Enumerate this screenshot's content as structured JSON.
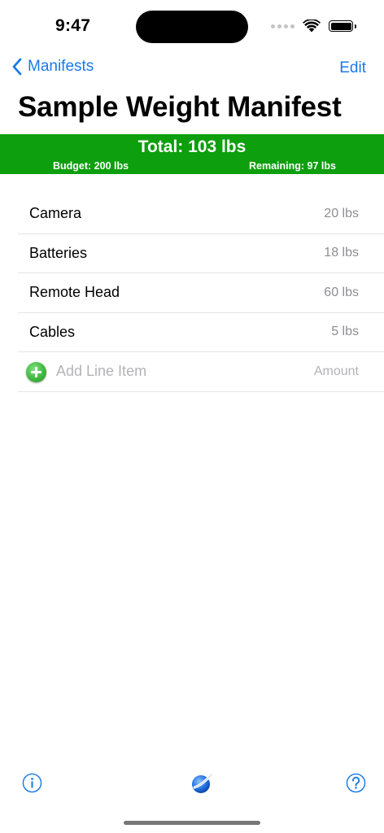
{
  "status_bar": {
    "time": "9:47",
    "icons": [
      "signal-dots-icon",
      "wifi-icon",
      "battery-icon"
    ]
  },
  "nav": {
    "back_label": "Manifests",
    "edit_label": "Edit"
  },
  "title": "Sample Weight Manifest",
  "summary": {
    "total": "Total: 103 lbs",
    "budget": "Budget: 200 lbs",
    "remaining": "Remaining: 97 lbs",
    "color": "#0d9f0d"
  },
  "items": [
    {
      "name": "Camera",
      "weight": "20 lbs"
    },
    {
      "name": "Batteries",
      "weight": "18 lbs"
    },
    {
      "name": "Remote Head",
      "weight": "60 lbs"
    },
    {
      "name": "Cables",
      "weight": "5 lbs"
    }
  ],
  "add_row": {
    "name_placeholder": "Add Line Item",
    "amount_placeholder": "Amount"
  },
  "toolbar": {
    "left_icon": "info-icon",
    "center_icon": "app-logo-icon",
    "right_icon": "help-icon"
  },
  "colors": {
    "accent": "#1a7ae8",
    "summary_green": "#0d9f0d"
  }
}
